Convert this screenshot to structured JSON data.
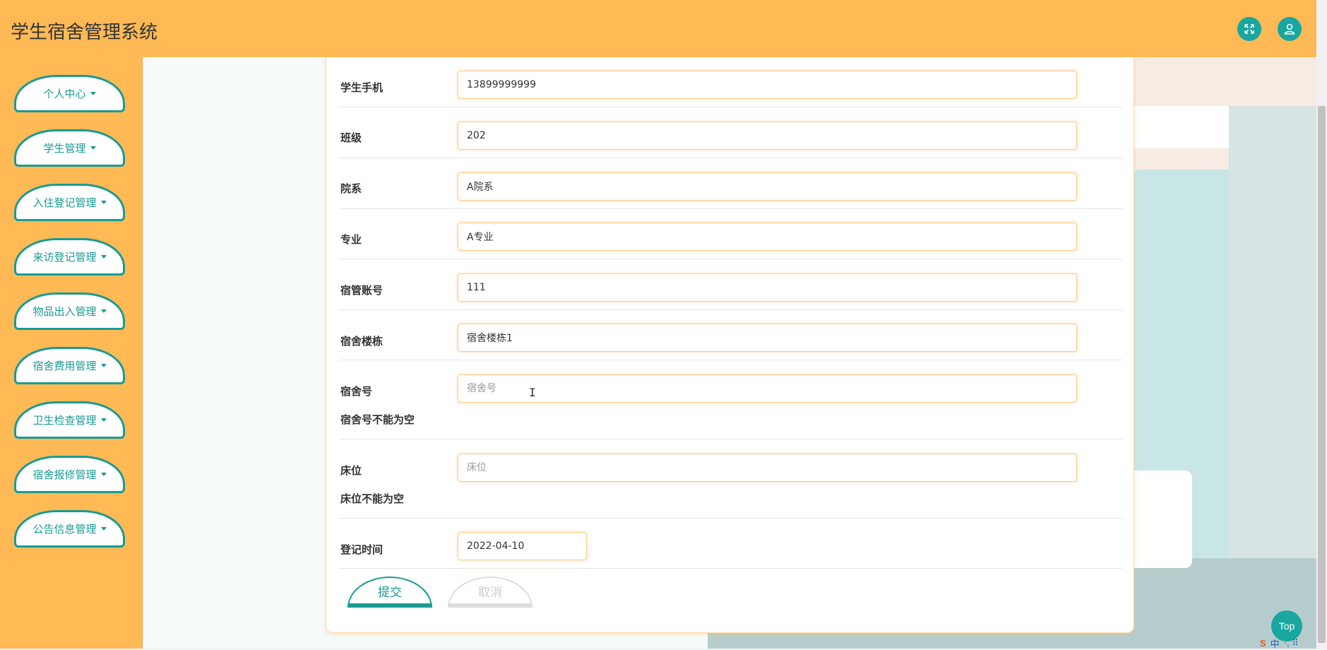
{
  "header": {
    "title": "学生宿舍管理系统"
  },
  "sidebar": {
    "items": [
      {
        "label": "个人中心"
      },
      {
        "label": "学生管理"
      },
      {
        "label": "入住登记管理"
      },
      {
        "label": "来访登记管理"
      },
      {
        "label": "物品出入管理"
      },
      {
        "label": "宿舍费用管理"
      },
      {
        "label": "卫生检查管理"
      },
      {
        "label": "宿舍报修管理"
      },
      {
        "label": "公告信息管理"
      }
    ]
  },
  "form": {
    "phone": {
      "label": "学生手机",
      "value": "13899999999"
    },
    "class": {
      "label": "班级",
      "value": "202"
    },
    "department": {
      "label": "院系",
      "value": "A院系"
    },
    "major": {
      "label": "专业",
      "value": "A专业"
    },
    "manager": {
      "label": "宿管账号",
      "value": "111"
    },
    "building": {
      "label": "宿舍楼栋",
      "value": "宿舍楼栋1"
    },
    "room": {
      "label": "宿舍号",
      "value": "",
      "placeholder": "宿舍号",
      "error": "宿舍号不能为空"
    },
    "bed": {
      "label": "床位",
      "value": "",
      "placeholder": "床位",
      "error": "床位不能为空"
    },
    "date": {
      "label": "登记时间",
      "value": "2022-04-10"
    },
    "submit_label": "提交",
    "cancel_label": "取消"
  },
  "top_button": "Top",
  "ime": {
    "logo": "S",
    "mode": "中",
    "extra": "·, ⠿"
  },
  "colors": {
    "header": "#ffb955",
    "accent": "#199b94"
  },
  "icons": {
    "fullscreen": "fullscreen-icon",
    "user": "user-icon"
  }
}
